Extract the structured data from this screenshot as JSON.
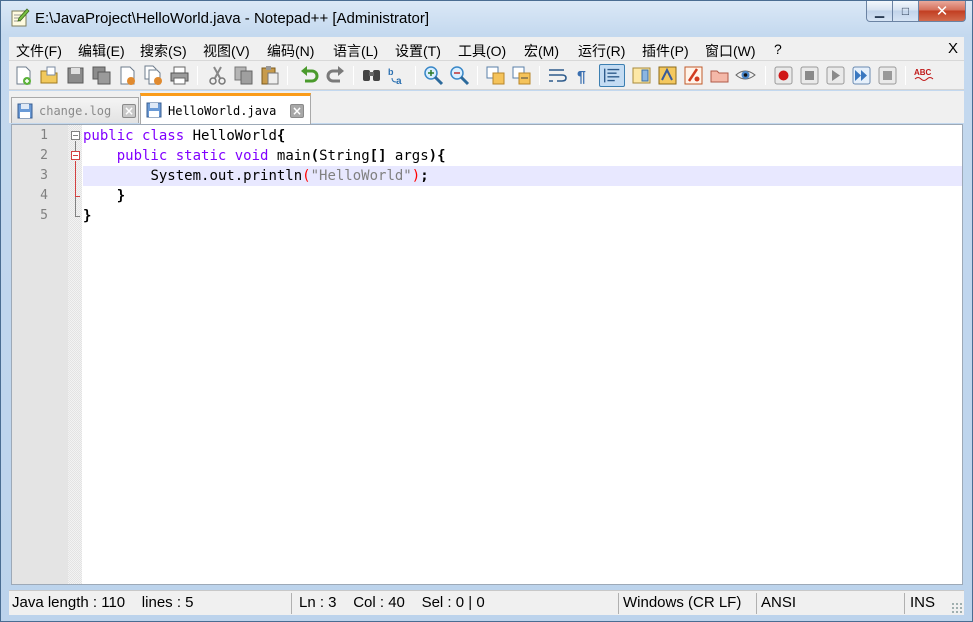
{
  "window": {
    "title": "E:\\JavaProject\\HelloWorld.java - Notepad++ [Administrator]",
    "minimize_glyph": "▁",
    "maximize_glyph": "□",
    "close_glyph": "✕"
  },
  "menu": {
    "items": [
      "文件(F)",
      "编辑(E)",
      "搜索(S)",
      "视图(V)",
      "编码(N)",
      "语言(L)",
      "设置(T)",
      "工具(O)",
      "宏(M)",
      "运行(R)",
      "插件(P)",
      "窗口(W)",
      "?"
    ],
    "close_label": "X"
  },
  "toolbar": {
    "buttons": [
      "new-file",
      "open-file",
      "save",
      "save-all",
      "close",
      "close-all",
      "print",
      "cut",
      "copy",
      "paste",
      "undo",
      "redo",
      "find",
      "replace",
      "zoom-in",
      "zoom-out",
      "sync-vertical",
      "sync-horizontal",
      "word-wrap",
      "show-all-characters",
      "indent-guide",
      "document-map",
      "function-list",
      "folder-as-workspace",
      "document-list",
      "monitoring",
      "record-macro",
      "stop-recording",
      "playback-macro",
      "run-macro-multiple",
      "save-macro",
      "spell-check"
    ],
    "active_button": "indent-guide",
    "spellcheck_label": "ABC"
  },
  "tabs": [
    {
      "label": "change.log",
      "active": false
    },
    {
      "label": "HelloWorld.java",
      "active": true
    }
  ],
  "editor": {
    "current_line": 3,
    "line_numbers": [
      "1",
      "2",
      "3",
      "4",
      "5"
    ],
    "lines": [
      {
        "indent": "",
        "kw1": "public",
        "kw2": "class",
        "rest": " HelloWorld",
        "brace": "{"
      },
      {
        "indent": "    ",
        "kw1": "public",
        "kw2": "static",
        "kw3": "void",
        "rest1": " main",
        "paren_open": "(",
        "rest2": "String",
        "brackets": "[]",
        "rest3": " args",
        "paren_close": ")",
        "brace": "{"
      },
      {
        "indent": "        ",
        "code": "System.out.println",
        "paren_open": "(",
        "string": "\"HelloWorld\"",
        "paren_close": ")",
        "semi": ";"
      },
      {
        "indent": "    ",
        "brace": "}"
      },
      {
        "indent": "",
        "brace": "}"
      }
    ]
  },
  "status": {
    "doc_type": "Java length : 110    lines : 5",
    "position": "Ln : 3    Col : 40    Sel : 0 | 0",
    "eol": "Windows (CR LF)",
    "encoding": "ANSI",
    "mode": "INS"
  },
  "colors": {
    "keyword": "#8000ff",
    "string": "#808080",
    "brace_highlight": "#ff0000",
    "current_line_bg": "#e8e8ff",
    "active_tab_accent": "#fa9c1a"
  }
}
